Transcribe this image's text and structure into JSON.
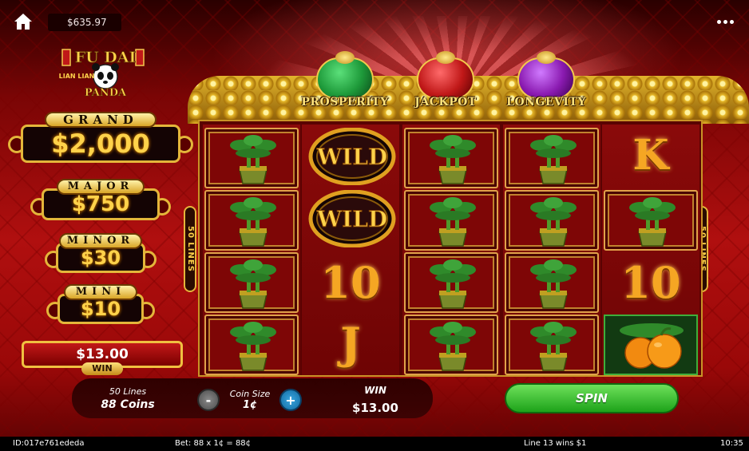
{
  "header": {
    "balance": "$635.97"
  },
  "logo": {
    "line1": "FU DAI",
    "line2": "LIAN LIAN",
    "line3": "PANDA"
  },
  "bags": [
    {
      "label": "PROSPERITY",
      "color": "#1e9a3a"
    },
    {
      "label": "JACKPOT",
      "color": "#c01818"
    },
    {
      "label": "LONGEVITY",
      "color": "#8a1ab0"
    }
  ],
  "jackpots": {
    "grand": {
      "title": "GRAND",
      "value": "$2,000"
    },
    "major": {
      "title": "MAJOR",
      "value": "$750"
    },
    "minor": {
      "title": "MINOR",
      "value": "$30"
    },
    "mini": {
      "title": "MINI",
      "value": "$10"
    }
  },
  "win_box": {
    "value": "$13.00",
    "label": "WIN"
  },
  "reels": {
    "lines_label": "50 LINES",
    "columns": [
      [
        "bamboo",
        "bamboo",
        "bamboo",
        "bamboo"
      ],
      [
        "wild",
        "wild",
        "10",
        "J"
      ],
      [
        "bamboo",
        "bamboo",
        "bamboo",
        "bamboo"
      ],
      [
        "bamboo",
        "bamboo",
        "bamboo",
        "bamboo"
      ],
      [
        "K",
        "bamboo",
        "10",
        "oranges"
      ]
    ],
    "wild_text": "WILD"
  },
  "bottom": {
    "lines_label": "50 Lines",
    "coins_label": "88 Coins",
    "minus_label": "-",
    "coin_size_label": "Coin Size",
    "coin_size_value": "1¢",
    "plus_label": "+",
    "win_label": "WIN",
    "win_value": "$13.00",
    "spin_label": "SPIN"
  },
  "status": {
    "id": "ID:017e761ededa",
    "bet": "Bet: 88 x 1¢ = 88¢",
    "line_win": "Line 13 wins $1",
    "time": "10:35"
  }
}
